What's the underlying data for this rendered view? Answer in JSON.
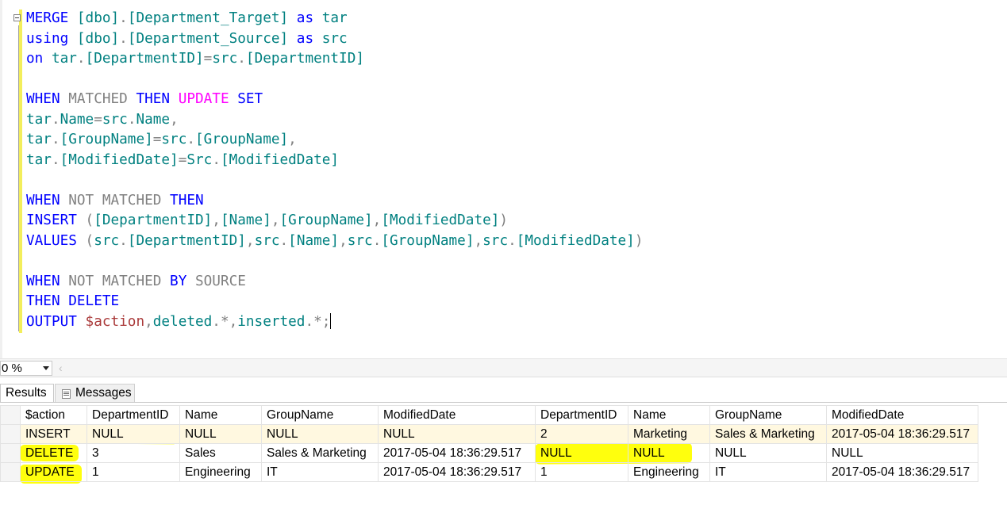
{
  "editor": {
    "lines": [
      [
        {
          "c": "k",
          "t": "MERGE "
        },
        {
          "c": "t",
          "t": "[dbo]"
        },
        {
          "c": "p",
          "t": "."
        },
        {
          "c": "t",
          "t": "[Department_Target] "
        },
        {
          "c": "k",
          "t": "as "
        },
        {
          "c": "t",
          "t": "tar"
        }
      ],
      [
        {
          "c": "k",
          "t": "using "
        },
        {
          "c": "t",
          "t": "[dbo]"
        },
        {
          "c": "p",
          "t": "."
        },
        {
          "c": "t",
          "t": "[Department_Source] "
        },
        {
          "c": "k",
          "t": "as "
        },
        {
          "c": "t",
          "t": "src"
        }
      ],
      [
        {
          "c": "k",
          "t": "on "
        },
        {
          "c": "t",
          "t": "tar"
        },
        {
          "c": "p",
          "t": "."
        },
        {
          "c": "t",
          "t": "[DepartmentID]"
        },
        {
          "c": "p",
          "t": "="
        },
        {
          "c": "t",
          "t": "src"
        },
        {
          "c": "p",
          "t": "."
        },
        {
          "c": "t",
          "t": "[DepartmentID]"
        }
      ],
      [],
      [
        {
          "c": "k",
          "t": "WHEN "
        },
        {
          "c": "g",
          "t": "MATCHED "
        },
        {
          "c": "k",
          "t": "THEN "
        },
        {
          "c": "m",
          "t": "UPDATE "
        },
        {
          "c": "k",
          "t": "SET"
        }
      ],
      [
        {
          "c": "t",
          "t": "tar"
        },
        {
          "c": "p",
          "t": "."
        },
        {
          "c": "t",
          "t": "Name"
        },
        {
          "c": "p",
          "t": "="
        },
        {
          "c": "t",
          "t": "src"
        },
        {
          "c": "p",
          "t": "."
        },
        {
          "c": "t",
          "t": "Name"
        },
        {
          "c": "p",
          "t": ","
        }
      ],
      [
        {
          "c": "t",
          "t": "tar"
        },
        {
          "c": "p",
          "t": "."
        },
        {
          "c": "t",
          "t": "[GroupName]"
        },
        {
          "c": "p",
          "t": "="
        },
        {
          "c": "t",
          "t": "src"
        },
        {
          "c": "p",
          "t": "."
        },
        {
          "c": "t",
          "t": "[GroupName]"
        },
        {
          "c": "p",
          "t": ","
        }
      ],
      [
        {
          "c": "t",
          "t": "tar"
        },
        {
          "c": "p",
          "t": "."
        },
        {
          "c": "t",
          "t": "[ModifiedDate]"
        },
        {
          "c": "p",
          "t": "="
        },
        {
          "c": "t",
          "t": "Src"
        },
        {
          "c": "p",
          "t": "."
        },
        {
          "c": "t",
          "t": "[ModifiedDate]"
        }
      ],
      [],
      [
        {
          "c": "k",
          "t": "WHEN "
        },
        {
          "c": "g",
          "t": "NOT MATCHED "
        },
        {
          "c": "k",
          "t": "THEN"
        }
      ],
      [
        {
          "c": "k",
          "t": "INSERT "
        },
        {
          "c": "p",
          "t": "("
        },
        {
          "c": "t",
          "t": "[DepartmentID]"
        },
        {
          "c": "p",
          "t": ","
        },
        {
          "c": "t",
          "t": "[Name]"
        },
        {
          "c": "p",
          "t": ","
        },
        {
          "c": "t",
          "t": "[GroupName]"
        },
        {
          "c": "p",
          "t": ","
        },
        {
          "c": "t",
          "t": "[ModifiedDate]"
        },
        {
          "c": "p",
          "t": ")"
        }
      ],
      [
        {
          "c": "k",
          "t": "VALUES "
        },
        {
          "c": "p",
          "t": "("
        },
        {
          "c": "t",
          "t": "src"
        },
        {
          "c": "p",
          "t": "."
        },
        {
          "c": "t",
          "t": "[DepartmentID]"
        },
        {
          "c": "p",
          "t": ","
        },
        {
          "c": "t",
          "t": "src"
        },
        {
          "c": "p",
          "t": "."
        },
        {
          "c": "t",
          "t": "[Name]"
        },
        {
          "c": "p",
          "t": ","
        },
        {
          "c": "t",
          "t": "src"
        },
        {
          "c": "p",
          "t": "."
        },
        {
          "c": "t",
          "t": "[GroupName]"
        },
        {
          "c": "p",
          "t": ","
        },
        {
          "c": "t",
          "t": "src"
        },
        {
          "c": "p",
          "t": "."
        },
        {
          "c": "t",
          "t": "[ModifiedDate]"
        },
        {
          "c": "p",
          "t": ")"
        }
      ],
      [],
      [
        {
          "c": "k",
          "t": "WHEN "
        },
        {
          "c": "g",
          "t": "NOT MATCHED "
        },
        {
          "c": "k",
          "t": "BY "
        },
        {
          "c": "g",
          "t": "SOURCE"
        }
      ],
      [
        {
          "c": "k",
          "t": "THEN DELETE"
        }
      ],
      [
        {
          "c": "k",
          "t": "OUTPUT "
        },
        {
          "c": "v",
          "t": "$action"
        },
        {
          "c": "p",
          "t": ","
        },
        {
          "c": "t",
          "t": "deleted"
        },
        {
          "c": "p",
          "t": ".*,"
        },
        {
          "c": "t",
          "t": "inserted"
        },
        {
          "c": "p",
          "t": ".*;"
        }
      ]
    ]
  },
  "zoom": {
    "value": "0 %",
    "scroll_left_glyph": "‹"
  },
  "tabs": {
    "results": "Results",
    "messages": "Messages"
  },
  "grid": {
    "columns": [
      "$action",
      "DepartmentID",
      "Name",
      "GroupName",
      "ModifiedDate",
      "DepartmentID",
      "Name",
      "GroupName",
      "ModifiedDate"
    ],
    "rows": [
      [
        "INSERT",
        "NULL",
        "NULL",
        "NULL",
        "NULL",
        "2",
        "Marketing",
        "Sales & Marketing",
        "2017-05-04 18:36:29.517"
      ],
      [
        "DELETE",
        "3",
        "Sales",
        "Sales & Marketing",
        "2017-05-04 18:36:29.517",
        "NULL",
        "NULL",
        "NULL",
        "NULL"
      ],
      [
        "UPDATE",
        "1",
        "Engineering",
        "IT",
        "2017-05-04 18:36:29.517",
        "1",
        "Engineering",
        "IT",
        "2017-05-04 18:36:29.517"
      ]
    ]
  },
  "colors": {
    "keyword": "#0000ff",
    "keyword_gray": "#808080",
    "update_keyword": "#ff00ff",
    "identifier": "#008080",
    "variable": "#aa3a3a",
    "highlighter": "#ffff00",
    "change_bar": "#f3ee5b"
  }
}
